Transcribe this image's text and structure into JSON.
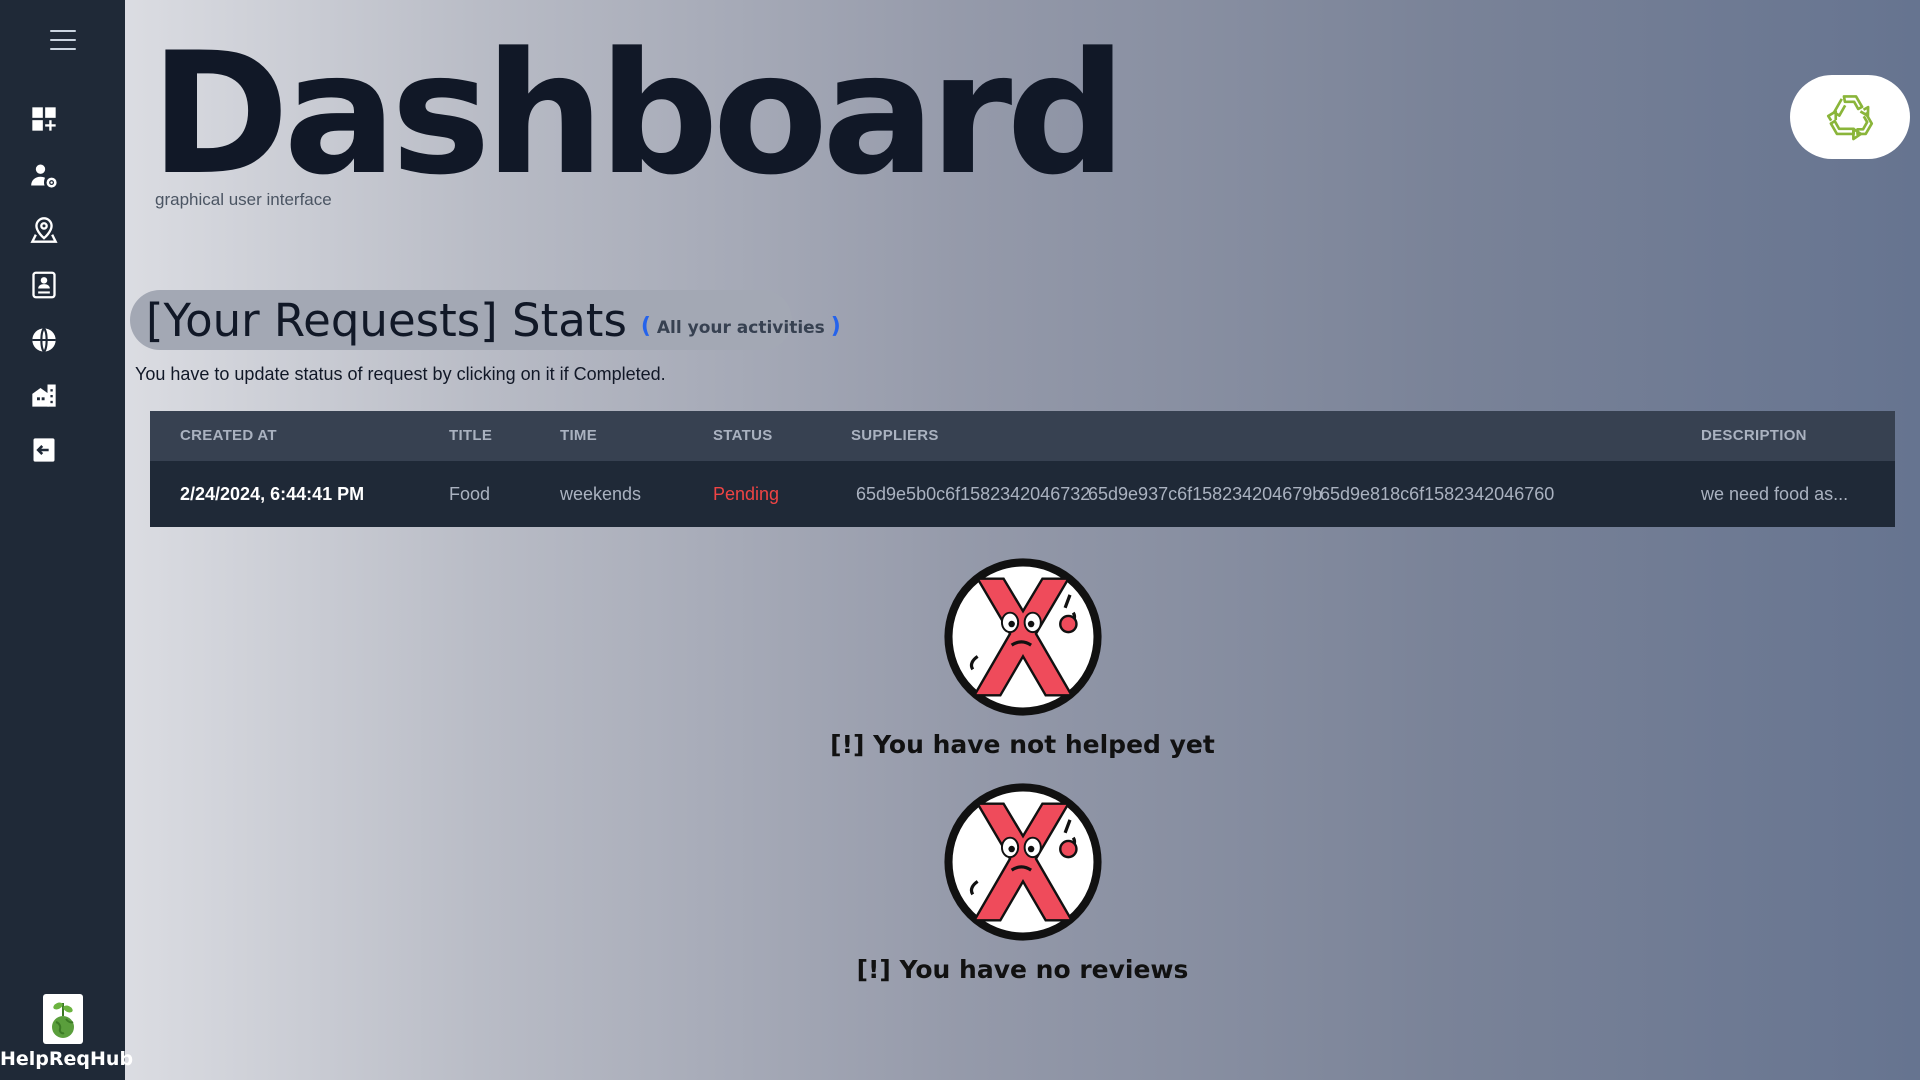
{
  "header": {
    "title": "Dashboard",
    "subtitle": "graphical user interface"
  },
  "sidebar": {
    "items": [
      {
        "icon": "dashboard-add-icon"
      },
      {
        "icon": "user-settings-icon"
      },
      {
        "icon": "location-pin-icon"
      },
      {
        "icon": "contact-card-icon"
      },
      {
        "icon": "globe-icon"
      },
      {
        "icon": "buildings-icon"
      },
      {
        "icon": "logout-icon"
      }
    ],
    "brand_name": "HelpReqHub"
  },
  "stats": {
    "title": "[Your Requests] Stats",
    "paren_open": "(",
    "link_label": "All your activities",
    "paren_close": ")",
    "hint": "You have to update status of request by clicking on it if Completed."
  },
  "table": {
    "headers": {
      "created_at": "CREATED AT",
      "title": "TITLE",
      "time": "TIME",
      "status": "STATUS",
      "suppliers": "SUPPLIERS",
      "description": "DESCRIPTION"
    },
    "rows": [
      {
        "created_at": "2/24/2024, 6:44:41 PM",
        "title": "Food",
        "time": "weekends",
        "status": "Pending",
        "suppliers": [
          "65d9e5b0c6f1582342046732",
          "65d9e937c6f158234204679b",
          "65d9e818c6f1582342046760"
        ],
        "description": "we need food as..."
      }
    ]
  },
  "empty_states": {
    "not_helped": "[!] You have not helped yet",
    "no_reviews": "[!] You have no reviews"
  },
  "colors": {
    "sidebar_bg": "#1f2937",
    "table_header_bg": "#374151",
    "table_row_bg": "#1f2937",
    "status_pending": "#ef4444",
    "accent_blue": "#2563eb",
    "recycle_green": "#8ab53a"
  }
}
